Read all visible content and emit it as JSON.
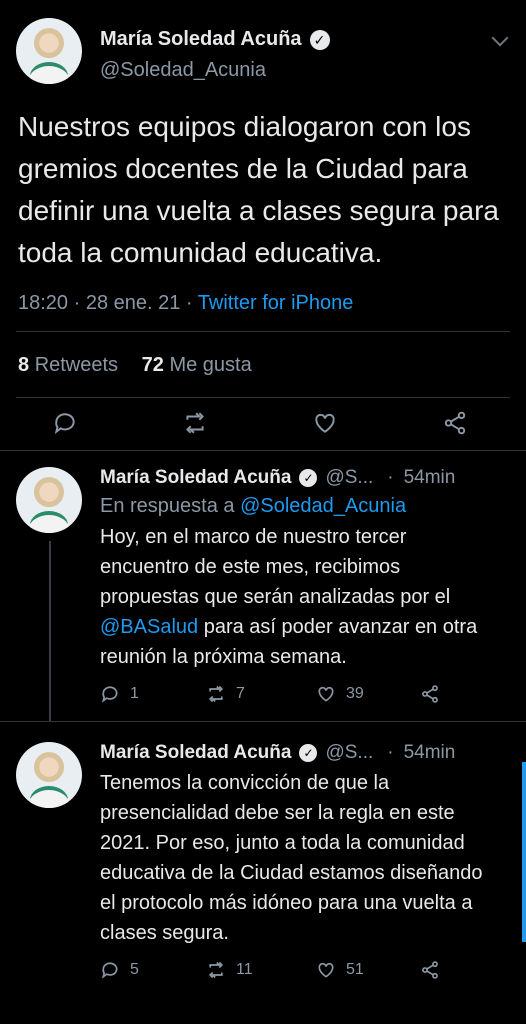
{
  "main_tweet": {
    "display_name": "María Soledad Acuña",
    "handle": "@Soledad_Acunia",
    "text": "Nuestros equipos dialogaron con los gremios docentes de la Ciudad para definir una vuelta a clases segura para toda la comunidad educativa.",
    "time": "18:20 · 28 ene. 21 · ",
    "source": "Twitter for iPhone",
    "retweets_count": "8",
    "retweets_label": "Retweets",
    "likes_count": "72",
    "likes_label": "Me gusta"
  },
  "icons": {
    "reply": "reply-icon",
    "retweet": "retweet-icon",
    "like": "heart-icon",
    "share": "share-icon",
    "verified": "verified-badge-icon",
    "menu": "chevron-down-icon"
  },
  "colors": {
    "background": "#000000",
    "link": "#1d9bf0",
    "muted": "#8b98a5",
    "text": "#e7e9ea"
  },
  "replies": [
    {
      "display_name": "María Soledad Acuña",
      "handle": "@S...",
      "dot": "·",
      "time": "54min",
      "in_reply_prefix": "En respuesta a ",
      "in_reply_handle": "@Soledad_Acunia",
      "text_before_link": "Hoy, en el marco de nuestro tercer encuentro de este mes, recibimos propuestas que serán analizadas por el ",
      "link": "@BASalud",
      "text_after_link": " para así poder avanzar en otra reunión la próxima semana.",
      "replies_count": "1",
      "retweets_count": "7",
      "likes_count": "39"
    },
    {
      "display_name": "María Soledad Acuña",
      "handle": "@S...",
      "dot": "·",
      "time": "54min",
      "text": "Tenemos la convicción de que la presencialidad debe ser la regla en este 2021. Por eso, junto a toda la comunidad educativa de la Ciudad estamos diseñando el protocolo más idóneo para una vuelta a clases segura.",
      "replies_count": "5",
      "retweets_count": "11",
      "likes_count": "51"
    }
  ]
}
